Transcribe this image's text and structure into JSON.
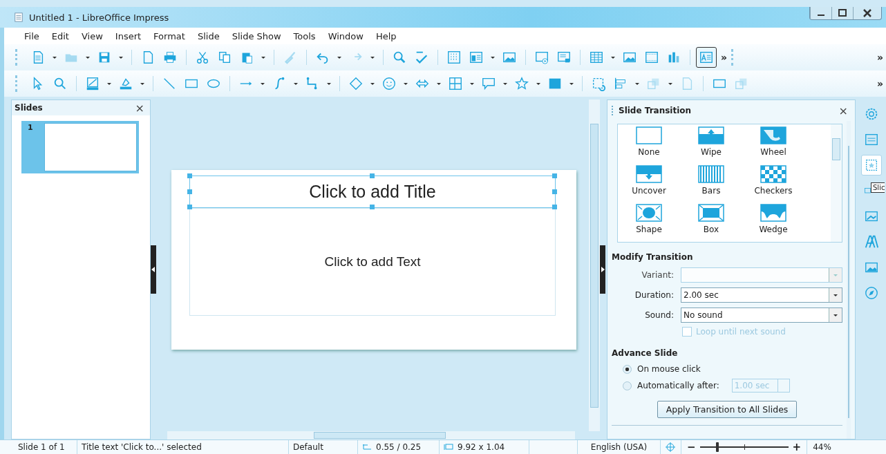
{
  "window": {
    "title": "Untitled 1 - LibreOffice Impress"
  },
  "menu": [
    "File",
    "Edit",
    "View",
    "Insert",
    "Format",
    "Slide",
    "Slide Show",
    "Tools",
    "Window",
    "Help"
  ],
  "toolbars": [
    {
      "overflow_marks": [
        "»",
        "»"
      ]
    },
    {
      "overflow_marks": [
        "»"
      ]
    }
  ],
  "slides_pane": {
    "title": "Slides",
    "close": "×",
    "slides": [
      {
        "number": "1",
        "selected": true
      }
    ]
  },
  "slide": {
    "title_placeholder": {
      "text": "Click to add Title",
      "selected": true
    },
    "body_placeholder": {
      "text": "Click to add Text"
    }
  },
  "sidebar": {
    "title": "Slide Transition",
    "close": "×",
    "transitions": [
      "None",
      "Wipe",
      "Wheel",
      "Uncover",
      "Bars",
      "Checkers",
      "Shape",
      "Box",
      "Wedge"
    ],
    "modify_heading": "Modify Transition",
    "fields": [
      {
        "label": "Variant:",
        "disabled": true
      },
      {
        "label": "Duration:",
        "value": "2.00 sec",
        "disabled": false
      },
      {
        "label": "Sound:",
        "value": "No sound",
        "disabled": false
      }
    ],
    "loop": {
      "label": "Loop until next sound",
      "checked": false,
      "disabled": true
    },
    "advance_heading": "Advance Slide",
    "advance_options": [
      {
        "label": "On mouse click",
        "selected": true
      },
      {
        "label": "Automatically after:",
        "selected": false
      }
    ],
    "spin": {
      "value": "1.00 sec",
      "disabled": true
    },
    "apply_button": "Apply Transition to All Slides"
  },
  "deck_tabs": [
    {
      "selected": false
    },
    {
      "selected": false
    },
    {
      "selected": true
    },
    {
      "selected": false
    },
    {
      "selected": false
    },
    {
      "selected": false
    },
    {
      "selected": false
    },
    {
      "selected": false
    }
  ],
  "tooltip": "Slic",
  "status_bar": {
    "slide": "Slide 1 of 1",
    "selection": "Title text 'Click to...' selected",
    "master": "Default",
    "position": "0.55 / 0.25",
    "size": "9.92 x 1.04",
    "language": "English (USA)",
    "zoom_minus": "−",
    "zoom_plus": "+",
    "zoom": {
      "level": 0.2
    },
    "zoom_percent": "44%"
  }
}
